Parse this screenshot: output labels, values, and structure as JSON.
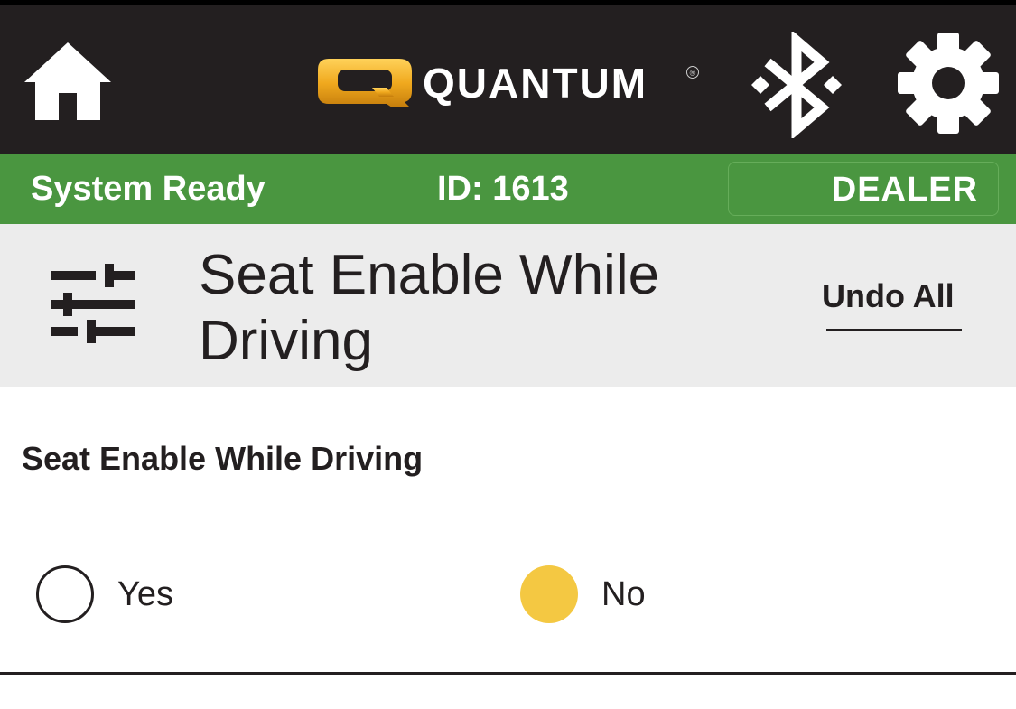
{
  "header": {
    "brand_name": "QUANTUM",
    "brand_mark": "Q",
    "registered_mark": "®",
    "icons": {
      "home": "home-icon",
      "bluetooth": "bluetooth-icon",
      "settings": "gear-icon"
    },
    "colors": {
      "background": "#231f20",
      "logo_gold": "#f0a91e"
    }
  },
  "status": {
    "text": "System Ready",
    "id_text": "ID: 1613",
    "mode_button_label": "DEALER",
    "colors": {
      "background": "#4a9640"
    }
  },
  "panel": {
    "icon": "sliders-icon",
    "title": "Seat Enable While Driving",
    "undo_label": "Undo All"
  },
  "setting": {
    "label": "Seat Enable While Driving",
    "options": [
      {
        "label": "Yes",
        "selected": false
      },
      {
        "label": "No",
        "selected": true
      }
    ],
    "colors": {
      "selected": "#f4c842"
    }
  }
}
